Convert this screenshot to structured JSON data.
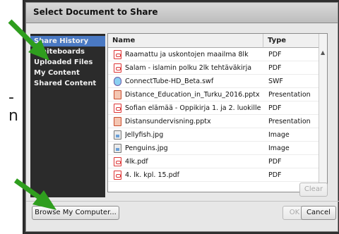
{
  "background": {
    "letters": [
      "-",
      "n"
    ]
  },
  "dialog": {
    "title": "Select Document to Share"
  },
  "nav": {
    "items": [
      {
        "label": "Share History",
        "selected": true
      },
      {
        "label": "Whiteboards",
        "selected": false
      },
      {
        "label": "Uploaded Files",
        "selected": false
      },
      {
        "label": "My Content",
        "selected": false
      },
      {
        "label": "Shared Content",
        "selected": false
      }
    ]
  },
  "table": {
    "columns": [
      "Name",
      "Type"
    ],
    "rows": [
      {
        "name": "Raamattu ja uskontojen maailma 8lk",
        "type": "PDF",
        "icon": "pdf-file-icon"
      },
      {
        "name": "Salam - islamin polku 2lk tehtäväkirja",
        "type": "PDF",
        "icon": "pdf-file-icon"
      },
      {
        "name": "ConnectTube-HD_Beta.swf",
        "type": "SWF",
        "icon": "swf-file-icon"
      },
      {
        "name": "Distance_Education_in_Turku_2016.pptx",
        "type": "Presentation",
        "icon": "presentation-file-icon"
      },
      {
        "name": "Sofian elämää - Oppikirja 1. ja 2. luokille",
        "type": "PDF",
        "icon": "pdf-file-icon"
      },
      {
        "name": "Distansundervisning.pptx",
        "type": "Presentation",
        "icon": "presentation-file-icon"
      },
      {
        "name": "Jellyfish.jpg",
        "type": "Image",
        "icon": "image-file-icon"
      },
      {
        "name": "Penguins.jpg",
        "type": "Image",
        "icon": "image-file-icon"
      },
      {
        "name": "4lk.pdf",
        "type": "PDF",
        "icon": "pdf-file-icon"
      },
      {
        "name": "4. lk. kpl. 15.pdf",
        "type": "PDF",
        "icon": "pdf-file-icon"
      }
    ]
  },
  "buttons": {
    "clear": "Clear",
    "browse": "Browse My Computer...",
    "ok": "OK",
    "cancel": "Cancel"
  },
  "colors": {
    "arrow": "#2f9e1e",
    "selection": "#4a79c3"
  }
}
